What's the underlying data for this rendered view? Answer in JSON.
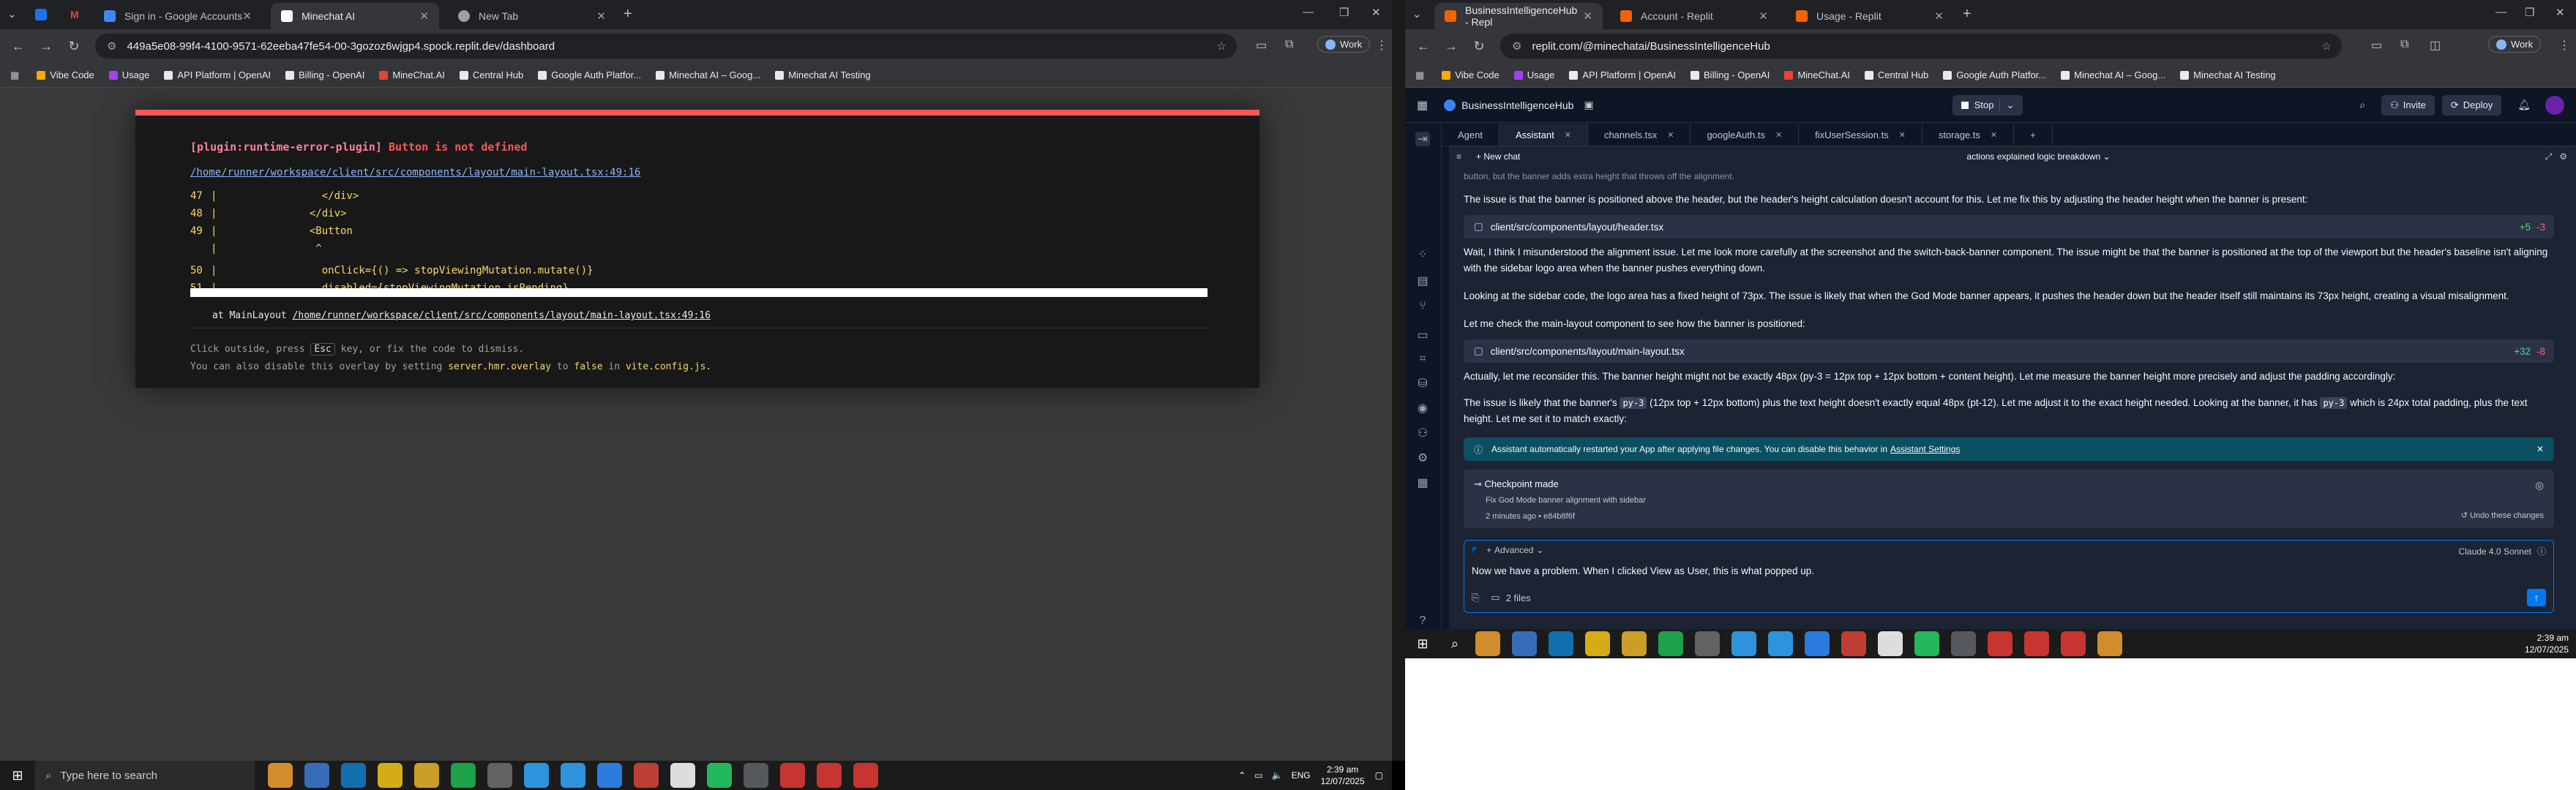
{
  "left": {
    "tabs": [
      {
        "title": "Sign in - Google Accounts",
        "color": "#4285f4"
      },
      {
        "title": "Minechat AI",
        "color": "#ffffff"
      },
      {
        "title": "New Tab",
        "color": "#9aa0a6"
      }
    ],
    "url": "449a5e08-99f4-4100-9571-62eeba47fe54-00-3gozoz6wjgp4.spock.replit.dev/dashboard",
    "profile": "Work",
    "bookmarks": [
      "Vibe Code",
      "Usage",
      "API Platform | OpenAI",
      "Billing - OpenAI",
      "MineChat.AI",
      "Central Hub",
      "Google Auth Platfor...",
      "Minechat AI – Goog...",
      "Minechat AI Testing"
    ],
    "overlay": {
      "plugin": "[plugin:runtime-error-plugin]",
      "message": "Button is not defined",
      "file": "/home/runner/workspace/client/src/components/layout/main-layout.tsx:49:16",
      "code_lines": [
        {
          "n": "47",
          "text": "|                 </div>"
        },
        {
          "n": "48",
          "text": "|               </div>"
        },
        {
          "n": "49",
          "text": "|               <Button"
        },
        {
          "n": "",
          "text": "|                ^"
        },
        {
          "n": "50",
          "text": "|                 onClick={() => stopViewingMutation.mutate()}"
        },
        {
          "n": "51",
          "text": "|                 disabled={stopViewingMutation.isPending}"
        }
      ],
      "stack_prefix": "at MainLayout",
      "stack_file": "/home/runner/workspace/client/src/components/layout/main-layout.tsx:49:16",
      "hint1_a": "Click outside, press",
      "hint1_key": "Esc",
      "hint1_b": "key, or fix the code to dismiss.",
      "hint2_a": "You can also disable this overlay by setting",
      "hint2_code": "server.hmr.overlay",
      "hint2_b": "to",
      "hint2_false": "false",
      "hint2_c": "in",
      "hint2_file": "vite.config.js."
    }
  },
  "right": {
    "tabs": [
      {
        "title": "BusinessIntelligenceHub - Repl",
        "color": "#f26207"
      },
      {
        "title": "Account - Replit",
        "color": "#f26207"
      },
      {
        "title": "Usage - Replit",
        "color": "#f26207"
      }
    ],
    "url": "replit.com/@minechatai/BusinessIntelligenceHub",
    "profile": "Work",
    "bookmarks": [
      "Vibe Code",
      "Usage",
      "API Platform | OpenAI",
      "Billing - OpenAI",
      "MineChat.AI",
      "Central Hub",
      "Google Auth Platfor...",
      "Minechat AI – Goog...",
      "Minechat AI Testing"
    ],
    "project": "BusinessIntelligenceHub",
    "stop": "Stop",
    "invite": "Invite",
    "deploy": "Deploy",
    "editor_tabs": [
      "Agent",
      "Assistant",
      "channels.tsx",
      "googleAuth.ts",
      "fixUserSession.ts",
      "storage.ts"
    ],
    "new_chat": "New chat",
    "chat_title": "actions explained logic breakdown",
    "faded_line": "button, but the banner adds extra height that throws off the alignment.",
    "p1": "The issue is that the banner is positioned above the header, but the header's height calculation doesn't account for this. Let me fix this by adjusting the header height when the banner is present:",
    "file1": "client/src/components/layout/header.tsx",
    "file1_add": "+5",
    "file1_del": "-3",
    "p2": "Wait, I think I misunderstood the alignment issue. Let me look more carefully at the screenshot and the switch-back-banner component. The issue might be that the banner is positioned at the top of the viewport but the header's baseline isn't aligning with the sidebar logo area when the banner pushes everything down.",
    "p3": "Looking at the sidebar code, the logo area has a fixed height of 73px. The issue is likely that when the God Mode banner appears, it pushes the header down but the header itself still maintains its 73px height, creating a visual misalignment.",
    "p4": "Let me check the main-layout component to see how the banner is positioned:",
    "file2": "client/src/components/layout/main-layout.tsx",
    "file2_add": "+32",
    "file2_del": "-8",
    "p5": "Actually, let me reconsider this. The banner height might not be exactly 48px (py-3 = 12px top + 12px bottom + content height). Let me measure the banner height more precisely and adjust the padding accordingly:",
    "p6_a": "The issue is likely that the banner's",
    "p6_code1": "py-3",
    "p6_b": "(12px top + 12px bottom) plus the text height doesn't exactly equal 48px (pt-12). Let me adjust it to the exact height needed. Looking at the banner, it has",
    "p6_code2": "py-3",
    "p6_c": "which is 24px total padding, plus the text height. Let me set it to match exactly:",
    "banner_text": "Assistant automatically restarted your App after applying file changes. You can disable this behavior in",
    "banner_link": "Assistant Settings",
    "ckpt_title": "Checkpoint made",
    "ckpt_desc": "Fix God Mode banner alignment with sidebar",
    "ckpt_time": "2 minutes ago",
    "ckpt_hash": "e84b8f6f",
    "undo": "Undo these changes",
    "advanced": "Advanced",
    "model": "Claude 4.0 Sonnet",
    "input_text": "Now we have a problem. When I clicked View as User, this is what popped up.",
    "files": "2 files"
  },
  "taskbar": {
    "search_placeholder": "Type here to search",
    "time": "2:39 am",
    "date": "12/07/2025",
    "lang": "ENG",
    "right_time": "2:39 am",
    "right_date": "12/07/2025"
  }
}
